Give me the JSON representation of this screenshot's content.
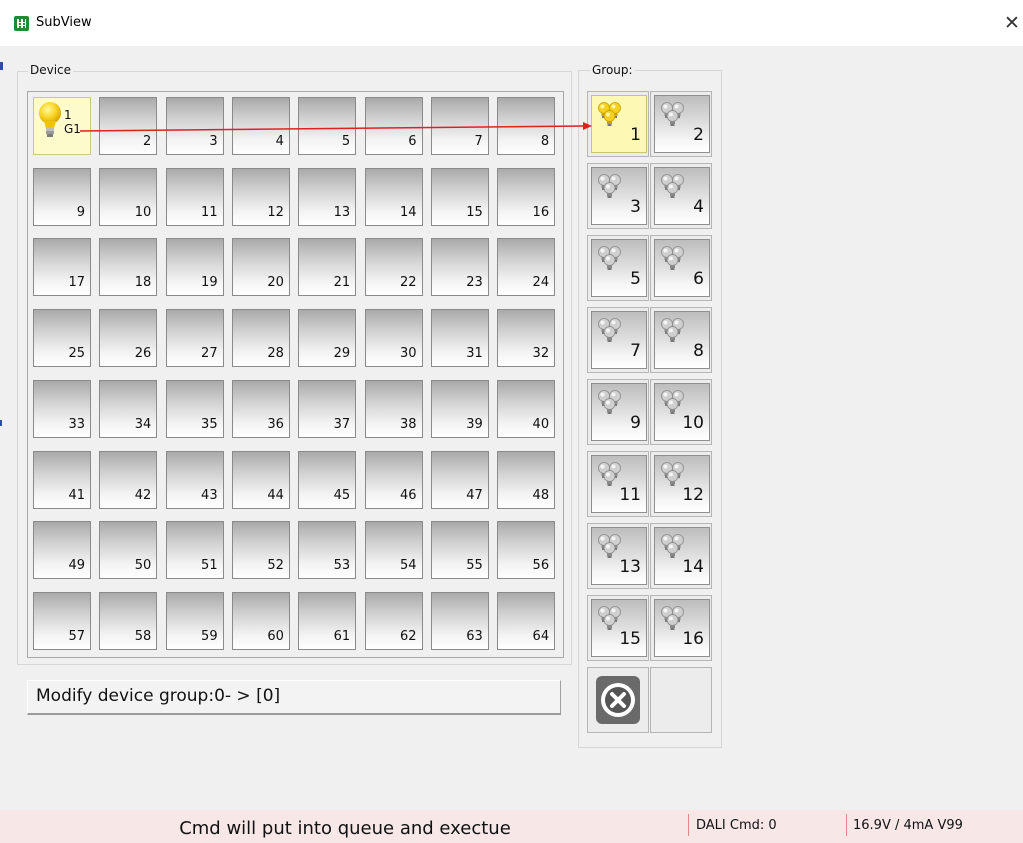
{
  "window": {
    "title": "SubView",
    "close_glyph": "✕"
  },
  "device_panel": {
    "label": "Device",
    "first_device": {
      "number": "1",
      "group": "G1"
    },
    "devices": [
      "2",
      "3",
      "4",
      "5",
      "6",
      "7",
      "8",
      "9",
      "10",
      "11",
      "12",
      "13",
      "14",
      "15",
      "16",
      "17",
      "18",
      "19",
      "20",
      "21",
      "22",
      "23",
      "24",
      "25",
      "26",
      "27",
      "28",
      "29",
      "30",
      "31",
      "32",
      "33",
      "34",
      "35",
      "36",
      "37",
      "38",
      "39",
      "40",
      "41",
      "42",
      "43",
      "44",
      "45",
      "46",
      "47",
      "48",
      "49",
      "50",
      "51",
      "52",
      "53",
      "54",
      "55",
      "56",
      "57",
      "58",
      "59",
      "60",
      "61",
      "62",
      "63",
      "64"
    ]
  },
  "group_panel": {
    "label": "Group:",
    "groups": [
      "1",
      "2",
      "3",
      "4",
      "5",
      "6",
      "7",
      "8",
      "9",
      "10",
      "11",
      "12",
      "13",
      "14",
      "15",
      "16"
    ],
    "active_group": "1"
  },
  "modify_text": "Modify device group:0- > [0]",
  "status": {
    "message": "Cmd will put into queue and exectue",
    "dali_cmd": "DALI Cmd: 0",
    "power": "16.9V / 4mA V99"
  },
  "colors": {
    "active_highlight": "#fdfacb",
    "arrow": "#e02020",
    "status_bg": "#f7e7e7",
    "app_icon": "#1e8a3a"
  },
  "icons": {
    "app": "grid-app-icon",
    "lamp_lit": "lit-bulb-icon",
    "lamp_group": "triple-bulb-icon",
    "clear": "close-circle-icon"
  }
}
